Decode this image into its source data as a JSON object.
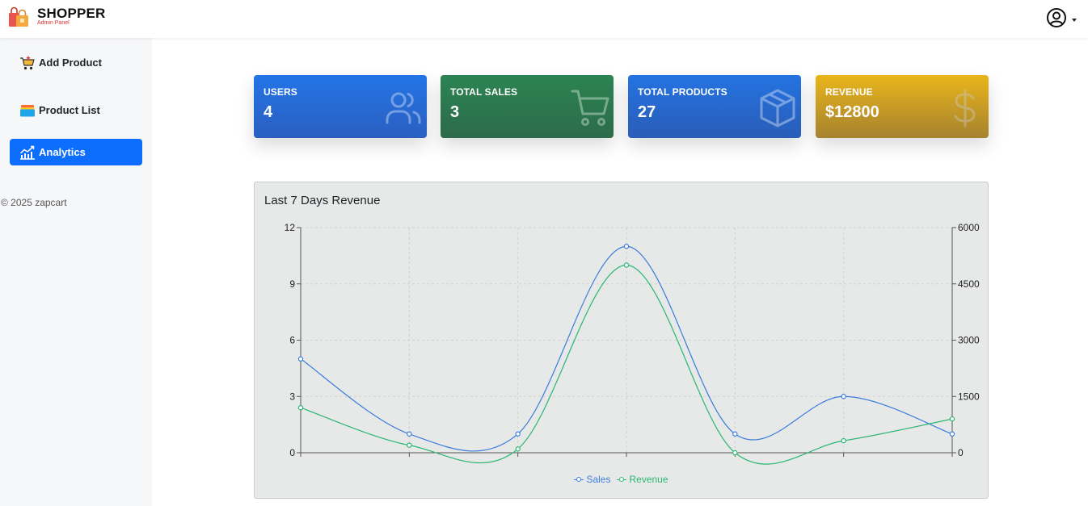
{
  "brand": {
    "name": "SHOPPER",
    "subtitle": "Admin Panel"
  },
  "header": {
    "user_icon": "user-circle-icon"
  },
  "sidebar": {
    "items": [
      {
        "label": "Add Product",
        "icon": "cart-add-icon",
        "active": false
      },
      {
        "label": "Product List",
        "icon": "stack-list-icon",
        "active": false
      },
      {
        "label": "Analytics",
        "icon": "analytics-chart-icon",
        "active": true
      }
    ],
    "copyright": "© 2025 zapcart"
  },
  "stats": {
    "users": {
      "label": "USERS",
      "value": "4",
      "icon": "users-icon",
      "color": "#2474e6"
    },
    "sales": {
      "label": "TOTAL SALES",
      "value": "3",
      "icon": "cart-icon",
      "color": "#2b8452"
    },
    "products": {
      "label": "TOTAL PRODUCTS",
      "value": "27",
      "icon": "box-icon",
      "color": "#2473e2"
    },
    "revenue": {
      "label": "REVENUE",
      "value": "$12800",
      "icon": "dollar-icon",
      "color": "#eab51b"
    }
  },
  "chart_data": {
    "type": "line",
    "title": "Last 7 Days Revenue",
    "x": [
      "",
      "",
      "",
      "",
      "",
      "",
      ""
    ],
    "series": [
      {
        "name": "Sales",
        "axis": "left",
        "color": "#3b7ddd",
        "values": [
          5,
          1,
          1,
          11,
          1,
          3,
          1
        ]
      },
      {
        "name": "Revenue",
        "axis": "right",
        "color": "#2bb673",
        "values": [
          1200,
          200,
          100,
          5000,
          0,
          320,
          900
        ]
      }
    ],
    "y_left": {
      "range": [
        0,
        12
      ],
      "ticks": [
        "0",
        "3",
        "6",
        "9",
        "12"
      ]
    },
    "y_right": {
      "range": [
        0,
        6000
      ],
      "ticks": [
        "0",
        "1500",
        "3000",
        "4500",
        "6000"
      ]
    },
    "grid": true,
    "legend": "bottom"
  }
}
